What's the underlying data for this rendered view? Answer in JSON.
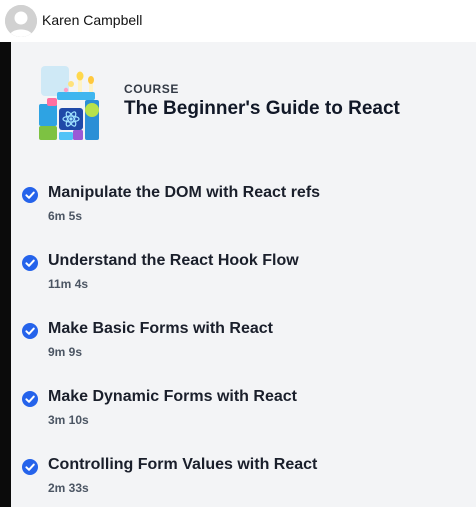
{
  "user": {
    "name": "Karen Campbell"
  },
  "course": {
    "label": "COURSE",
    "title": "The Beginner's Guide to React"
  },
  "lessons": [
    {
      "title": "Manipulate the DOM with React refs",
      "duration": "6m 5s",
      "completed": true
    },
    {
      "title": "Understand the React Hook Flow",
      "duration": "11m 4s",
      "completed": true
    },
    {
      "title": "Make Basic Forms with React",
      "duration": "9m 9s",
      "completed": true
    },
    {
      "title": "Make Dynamic Forms with React",
      "duration": "3m 10s",
      "completed": true
    },
    {
      "title": "Controlling Form Values with React",
      "duration": "2m 33s",
      "completed": true
    }
  ],
  "colors": {
    "check": "#2563eb",
    "panel": "#f3f4f6",
    "left_bar": "#0b0b0b"
  },
  "icons": {
    "avatar": "user-avatar-icon",
    "check": "check-circle-icon",
    "course": "course-illustration-icon"
  }
}
